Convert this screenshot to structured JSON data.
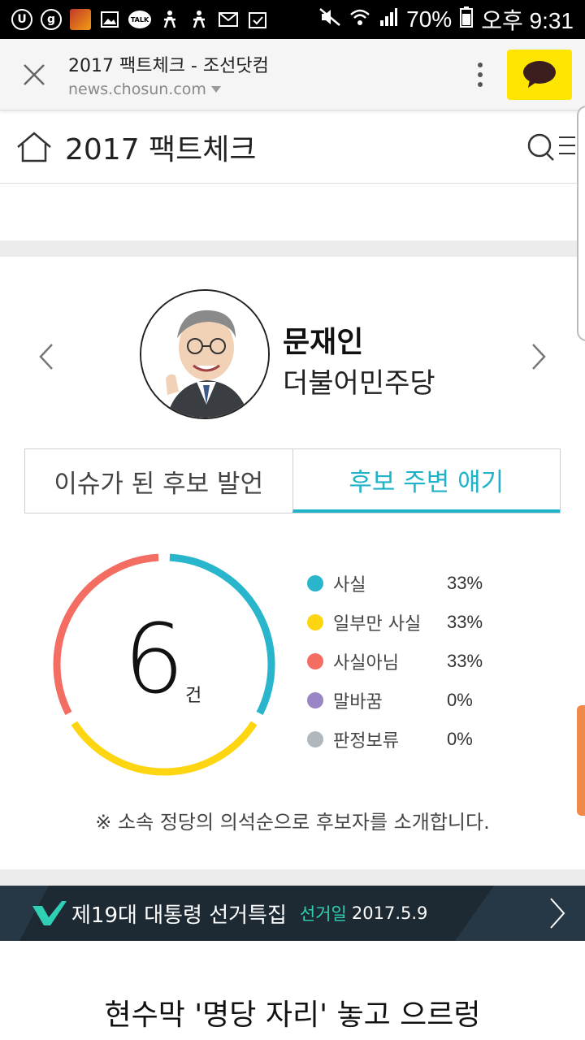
{
  "status_bar": {
    "battery": "70%",
    "time": "오후 9:31",
    "icons": [
      "u-plus-icon",
      "g-icon",
      "game-icon",
      "gallery-icon",
      "kakaotalk-icon",
      "figure-icon",
      "figure-icon",
      "mail-icon",
      "task-icon",
      "mute-icon",
      "wifi-icon",
      "signal-icon",
      "battery-icon"
    ],
    "talk_label": "TALK"
  },
  "browser": {
    "page_title": "2017 팩트체크 - 조선닷컴",
    "url": "news.chosun.com",
    "kakao_color": "#fee500"
  },
  "site": {
    "title": "2017 팩트체크"
  },
  "candidate": {
    "name": "문재인",
    "party": "더불어민주당"
  },
  "tabs": [
    {
      "label": "이슈가 된 후보 발언",
      "active": false
    },
    {
      "label": "후보 주변 얘기",
      "active": true
    }
  ],
  "stats": {
    "total": "6",
    "unit": "건",
    "items": [
      {
        "label": "사실",
        "percent": "33%",
        "color": "#29b6cc",
        "value": 33
      },
      {
        "label": "일부만 사실",
        "percent": "33%",
        "color": "#fdd511",
        "value": 33
      },
      {
        "label": "사실아님",
        "percent": "33%",
        "color": "#f46d63",
        "value": 33
      },
      {
        "label": "말바꿈",
        "percent": "0%",
        "color": "#9a86c4",
        "value": 0
      },
      {
        "label": "판정보류",
        "percent": "0%",
        "color": "#b0b8be",
        "value": 0
      }
    ],
    "note": "※ 소속 정당의 의석순으로 후보자를 소개합니다."
  },
  "banner": {
    "title": "제19대 대통령 선거특집",
    "date_label": "선거일",
    "date": "2017.5.9"
  },
  "headline": "현수막 '명당 자리' 놓고 으르렁"
}
